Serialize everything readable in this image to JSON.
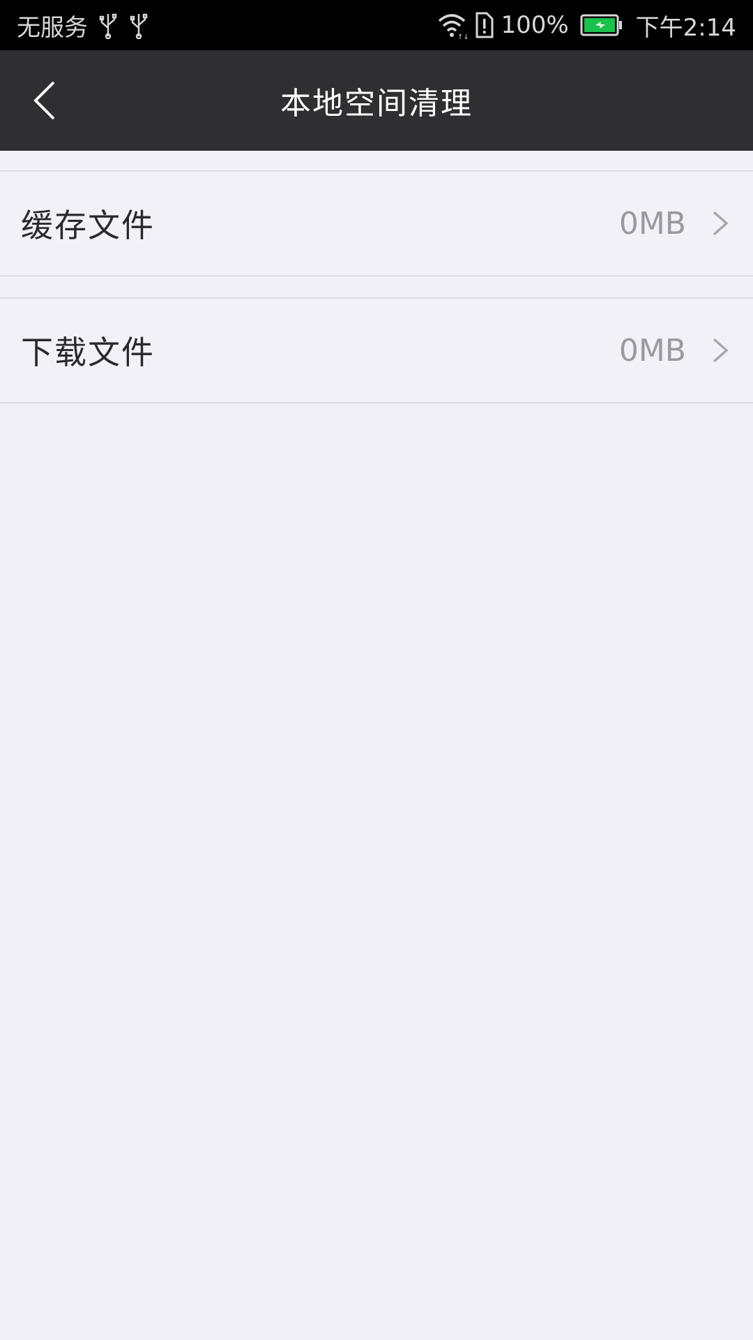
{
  "status_bar": {
    "carrier": "无服务",
    "battery_percent": "100%",
    "time": "下午2:14",
    "icons": [
      "usb-icon",
      "usb-icon",
      "wifi-icon",
      "sim-alert-icon",
      "battery-charging-icon"
    ],
    "battery_color": "#19c24a"
  },
  "app_bar": {
    "title": "本地空间清理",
    "back_icon": "chevron-left-icon",
    "background_color": "#2f2e33"
  },
  "rows": [
    {
      "label": "缓存文件",
      "value": "0MB",
      "icon": "chevron-right-icon"
    },
    {
      "label": "下载文件",
      "value": "0MB",
      "icon": "chevron-right-icon"
    }
  ],
  "colors": {
    "page_background": "#efeff5",
    "row_background": "#f2f1f7",
    "divider": "#dedde4",
    "value_text": "#9a99a0"
  }
}
